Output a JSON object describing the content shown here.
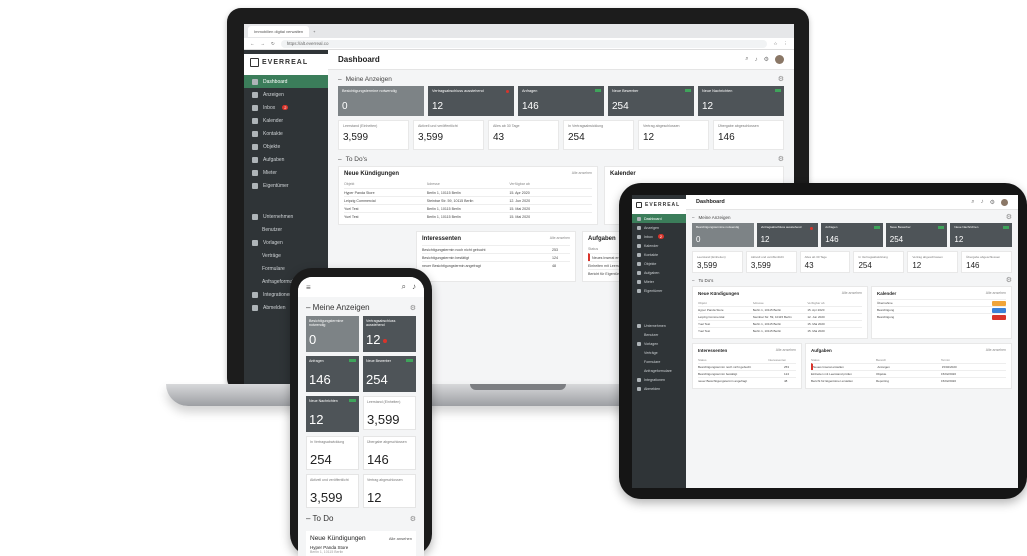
{
  "browser": {
    "tab": "Immobilien digital verwalten",
    "url": "https://alt.everreal.co"
  },
  "brand": "EVERREAL",
  "page_title": "Dashboard",
  "sidebar": {
    "items": [
      {
        "label": "Dashboard"
      },
      {
        "label": "Anzeigen"
      },
      {
        "label": "Inbox",
        "badge": "2"
      },
      {
        "label": "Kalender"
      },
      {
        "label": "Kontakte"
      },
      {
        "label": "Objekte"
      },
      {
        "label": "Aufgaben"
      },
      {
        "label": "Mieter"
      },
      {
        "label": "Eigentümer"
      }
    ],
    "lower": [
      {
        "label": "Unternehmen"
      },
      {
        "label": "Benutzer"
      },
      {
        "label": "Vorlagen"
      },
      {
        "label": "Verträge"
      },
      {
        "label": "Formulare"
      },
      {
        "label": "Anfrageformulare"
      },
      {
        "label": "Integrationen"
      },
      {
        "label": "Abmelden"
      }
    ]
  },
  "section_anzeigen": "Meine Anzeigen",
  "section_todos": "To Do's",
  "kpis": [
    {
      "label": "Besichtigungstermine notwendig",
      "value": "0"
    },
    {
      "label": "Vertragsabschluss ausstehend",
      "value": "12"
    },
    {
      "label": "Anfragen",
      "value": "146"
    },
    {
      "label": "Neue Bewerber",
      "value": "254"
    },
    {
      "label": "Neue Nachrichten",
      "value": "12"
    }
  ],
  "stats": [
    {
      "label": "Leerstand (Einheiten)",
      "value": "3,599"
    },
    {
      "label": "Aktivell und veröffentlicht",
      "value": "3,599"
    },
    {
      "label": "Alles ab 30 Tage",
      "value": "43"
    },
    {
      "label": "In Vertragsabwicklung",
      "value": "254"
    },
    {
      "label": "Vertrag abgeschlossen",
      "value": "12"
    },
    {
      "label": "Übergabe abgeschlossen",
      "value": "146"
    }
  ],
  "kuendigungen": {
    "title": "Neue Kündigungen",
    "link": "Alle ansehen",
    "columns": [
      "Objekt",
      "Adresse",
      "Verfügbar ab"
    ],
    "rows": [
      [
        "Hyper Panda Store",
        "Berlin 1, 10115 Berlin",
        "15. Apr 2020"
      ],
      [
        "Leipzig Commercial",
        "Steinbar Str. 59, 10115 Berlin",
        "12. Jun 2020"
      ],
      [
        "Yuel Test",
        "Berlin 1, 10115 Berlin",
        "15. Mai 2020"
      ],
      [
        "Yuel Test",
        "Berlin 1, 10115 Berlin",
        "15. Mai 2020"
      ]
    ]
  },
  "kalender": {
    "title": "Kalender",
    "link": "Alle ansehen",
    "items": [
      "Übernahme",
      "Besichtigung",
      "Besichtigung"
    ]
  },
  "interessenten": {
    "title": "Interessenten",
    "link": "Alle ansehen",
    "columns": [
      "Status",
      "Interessenten"
    ],
    "rows": [
      [
        "Besichtigungstermin noch nicht gebucht",
        "253"
      ],
      [
        "Besichtigungstermin bestätigt",
        "124"
      ],
      [
        "neuer Besichtigungstermin angefragt",
        "48"
      ]
    ]
  },
  "aufgaben": {
    "title": "Aufgaben",
    "link": "Alle ansehen",
    "columns": [
      "Status",
      "Bereich",
      "Termin"
    ],
    "rows": [
      [
        "Neues Inserat erstellen",
        "Anzeigen",
        "15/02/2020"
      ],
      [
        "Einheiten mit Leerstand prüfen",
        "Objekte",
        "15/02/2020"
      ],
      [
        "Bericht für Eigentümer erstellen",
        "Reporting",
        "15/02/2020"
      ]
    ]
  },
  "phone": {
    "section": "Meine Anzeigen",
    "todo": "To Do",
    "kuendigungen": "Neue Kündigungen",
    "link": "Alle ansehen",
    "first_item": "Hyper Panda Store",
    "first_item_sub": "Berlin 1, 10115 Berlin"
  },
  "colors": {
    "accent": "#3b7d5a",
    "sidebar": "#2f3437",
    "kpi": "#4e5458",
    "alert": "#d9342b"
  }
}
